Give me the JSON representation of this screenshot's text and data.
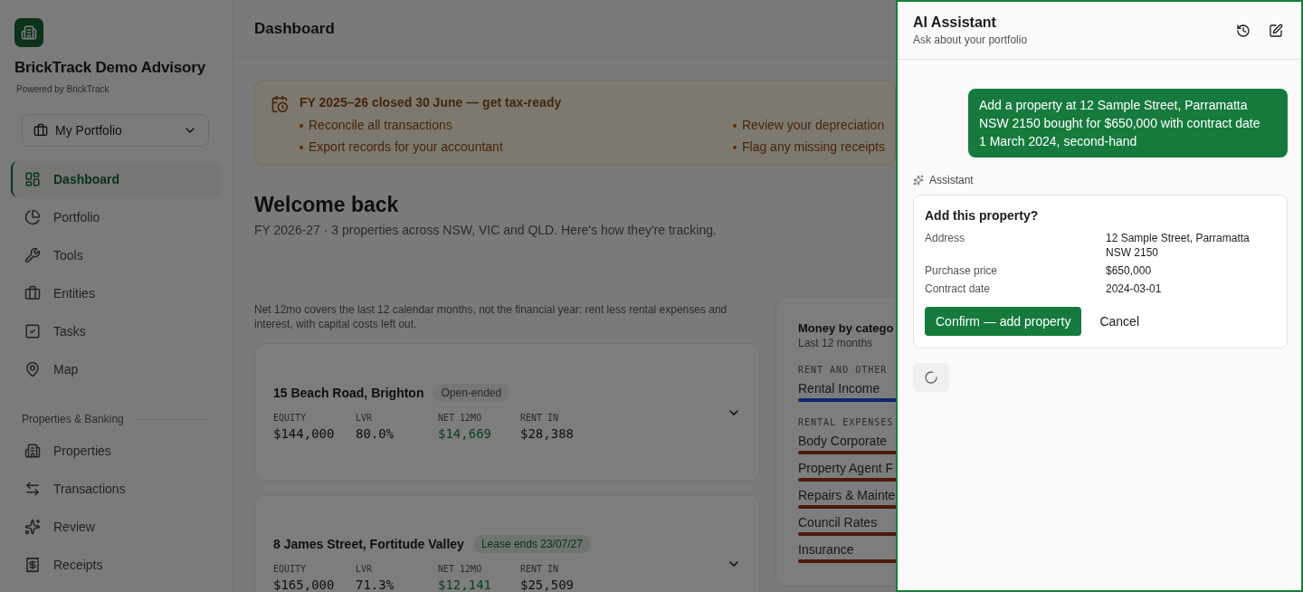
{
  "sidebar": {
    "brand": "BrickTrack Demo Advisory",
    "powered_by": "Powered by BrickTrack",
    "portfolio_select": "My Portfolio",
    "nav": [
      {
        "label": "Dashboard",
        "selected": true
      },
      {
        "label": "Portfolio",
        "selected": false
      },
      {
        "label": "Tools",
        "selected": false
      },
      {
        "label": "Entities",
        "selected": false
      },
      {
        "label": "Tasks",
        "selected": false
      },
      {
        "label": "Map",
        "selected": false
      }
    ],
    "section": "Properties & Banking",
    "section_nav": [
      {
        "label": "Properties",
        "selected": false
      },
      {
        "label": "Transactions",
        "selected": false
      },
      {
        "label": "Review",
        "selected": false
      },
      {
        "label": "Receipts",
        "selected": false
      }
    ]
  },
  "header": {
    "title": "Dashboard"
  },
  "banner": {
    "title": "FY 2025–26 closed 30 June — get tax-ready",
    "items": [
      "Reconcile all transactions",
      "Review your depreciation",
      "Export records for your accountant",
      "Flag any missing receipts"
    ]
  },
  "welcome": {
    "title": "Welcome back",
    "subtitle": "FY 2026-27 · 3 properties across NSW, VIC and QLD. Here's how they're tracking."
  },
  "note": "Net 12mo covers the last 12 calendar months, not the financial year: rent less rental expenses and interest, with capital costs left out.",
  "properties": [
    {
      "address": "15 Beach Road, Brighton",
      "badge": "Open-ended",
      "badge_positive": false,
      "metrics": [
        {
          "label": "EQUITY",
          "value": "$144,000",
          "positive": false
        },
        {
          "label": "LVR",
          "value": "80.0%",
          "positive": false
        },
        {
          "label": "NET 12MO",
          "value": "$14,669",
          "positive": true
        },
        {
          "label": "RENT IN",
          "value": "$28,388",
          "positive": false
        }
      ]
    },
    {
      "address": "8 James Street, Fortitude Valley",
      "badge": "Lease ends 23/07/27",
      "badge_positive": true,
      "metrics": [
        {
          "label": "EQUITY",
          "value": "$165,000",
          "positive": false
        },
        {
          "label": "LVR",
          "value": "71.3%",
          "positive": false
        },
        {
          "label": "NET 12MO",
          "value": "$12,141",
          "positive": true
        },
        {
          "label": "RENT IN",
          "value": "$25,509",
          "positive": false
        }
      ]
    }
  ],
  "money_panel": {
    "title": "Money by catego",
    "subtitle": "Last 12 months",
    "groups": [
      {
        "kind": "income",
        "heading": "RENT AND OTHER",
        "items": [
          "Rental Income"
        ]
      },
      {
        "kind": "expense",
        "heading": "RENTAL EXPENSES",
        "items": [
          "Body Corporate",
          "Property Agent F",
          "Repairs & Mainte",
          "Council Rates",
          "Insurance"
        ]
      }
    ]
  },
  "assistant": {
    "title": "AI Assistant",
    "subtitle": "Ask about your portfolio",
    "messages": [
      {
        "kind": "user",
        "text": "Add a property at 12 Sample Street, Parramatta NSW 2150 bought for $650,000 with contract date 1 March 2024, second-hand"
      },
      {
        "kind": "assistant",
        "author": "Assistant",
        "card": {
          "title": "Add this property?",
          "fields": [
            {
              "label": "Address",
              "value": "12 Sample Street, Parramatta NSW 2150"
            },
            {
              "label": "Purchase price",
              "value": "$650,000"
            },
            {
              "label": "Contract date",
              "value": "2024-03-01"
            }
          ],
          "confirm": "Confirm — add property",
          "cancel": "Cancel"
        }
      },
      {
        "kind": "loading"
      }
    ]
  }
}
